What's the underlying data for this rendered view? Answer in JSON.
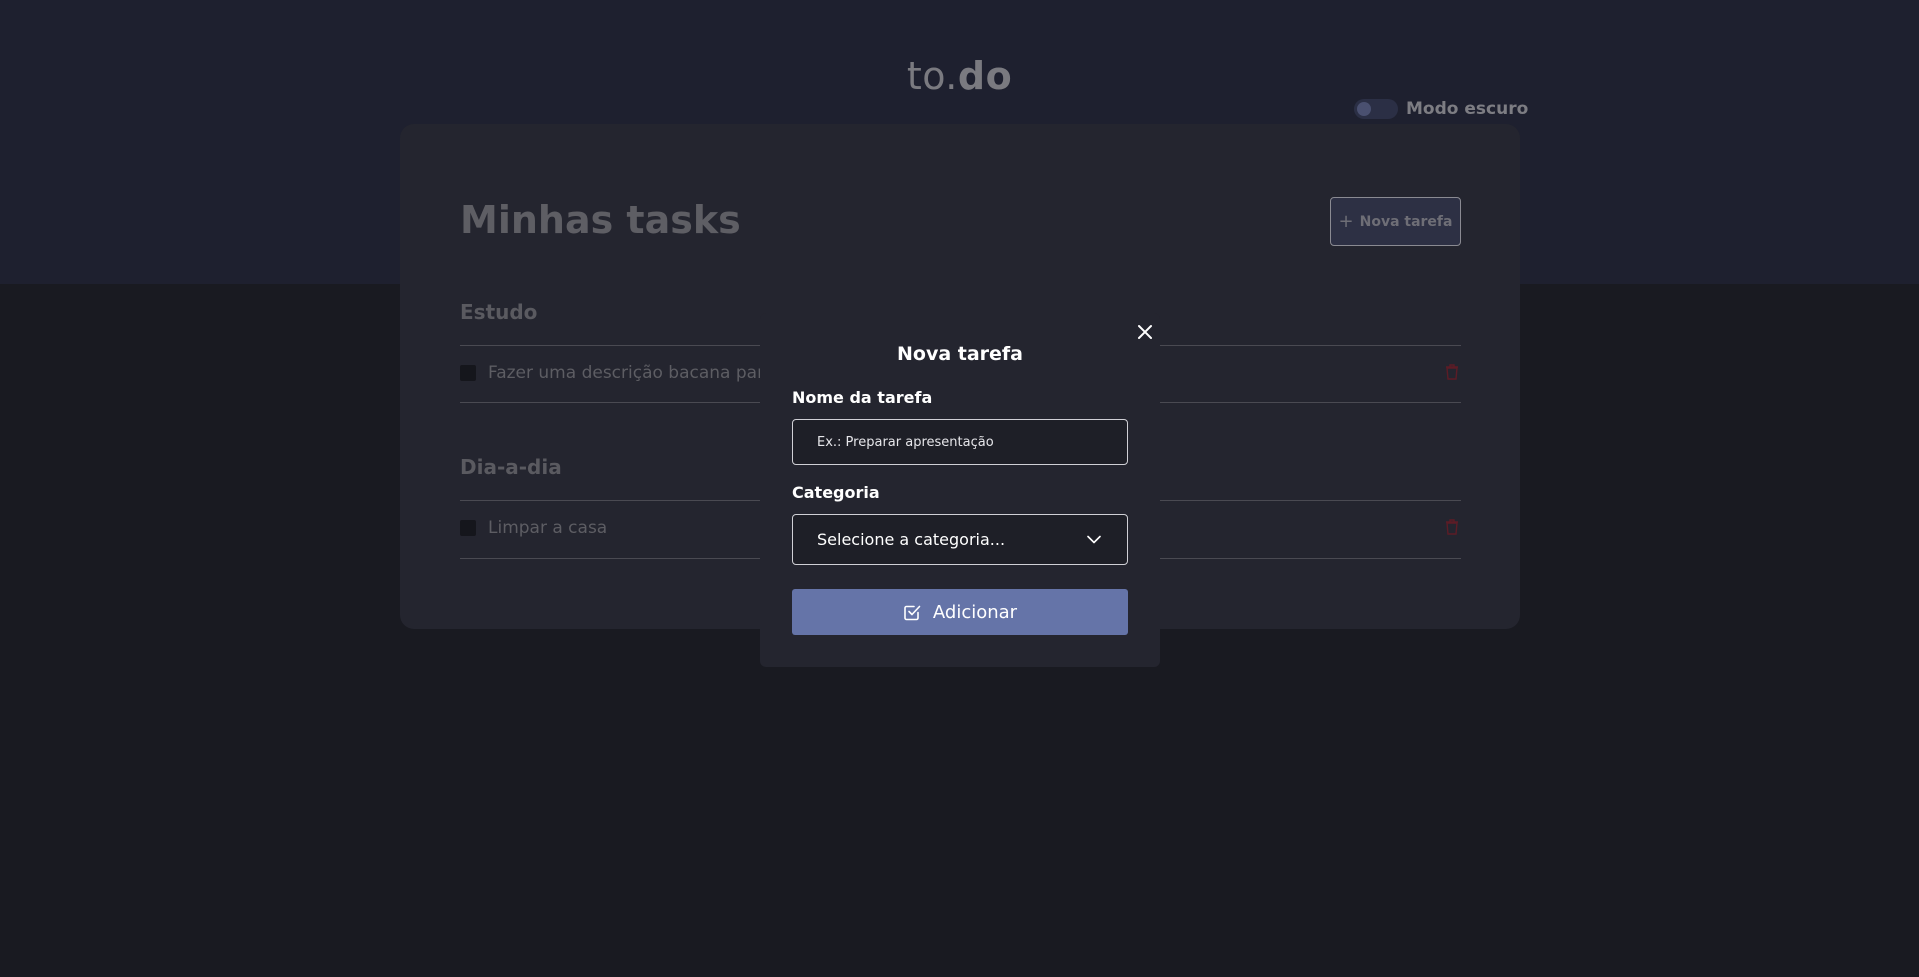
{
  "header": {
    "logo_light": "to.",
    "logo_bold": "do",
    "theme_toggle_label": "Modo escuro"
  },
  "main": {
    "title": "Minhas tasks",
    "new_task_button": "Nova tarefa",
    "categories": [
      {
        "name": "Estudo",
        "tasks": [
          {
            "text": "Fazer uma descrição bacana para"
          }
        ]
      },
      {
        "name": "Dia-a-dia",
        "tasks": [
          {
            "text": "Limpar a casa"
          }
        ]
      }
    ]
  },
  "modal": {
    "title": "Nova tarefa",
    "name_label": "Nome da tarefa",
    "name_placeholder": "Ex.: Preparar apresentação",
    "category_label": "Categoria",
    "category_selected": "Selecione a categoria...",
    "submit_label": "Adicionar"
  },
  "colors": {
    "accent": "#6574a8",
    "background": "#191a21",
    "card": "#24252f",
    "danger": "#7a1e2a"
  }
}
